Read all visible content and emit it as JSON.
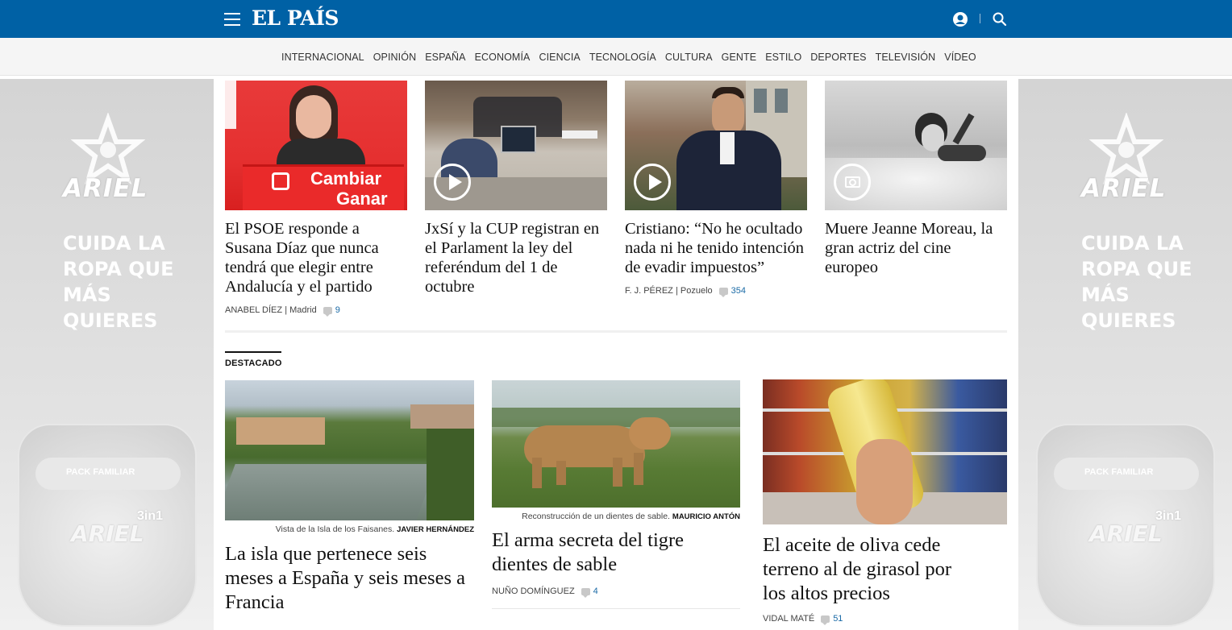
{
  "header": {
    "logo": "EL PAÍS",
    "bg_color": "#0061a5"
  },
  "nav": {
    "items": [
      "INTERNACIONAL",
      "OPINIÓN",
      "ESPAÑA",
      "ECONOMÍA",
      "CIENCIA",
      "TECNOLOGÍA",
      "CULTURA",
      "GENTE",
      "ESTILO",
      "DEPORTES",
      "TELEVISIÓN",
      "VÍDEO"
    ]
  },
  "ad": {
    "brand": "ARIEL",
    "slogan": "CUIDA LA ROPA QUE MÁS QUIERES",
    "pack_text": "PACK FAMILIAR",
    "pack_badge": "3in1"
  },
  "top_stories": [
    {
      "headline": "El PSOE responde a Susana Díaz que nunca tendrá que elegir entre Andalucía y el partido",
      "author": "ANABEL DÍEZ",
      "location": "| Madrid",
      "comments": "9",
      "media": "none",
      "image_icon": "politician-at-podium-image"
    },
    {
      "headline": "JxSí y la CUP registran en el Parlament la ley del referéndum del 1 de octubre",
      "author": "",
      "location": "",
      "comments": "",
      "media": "video",
      "image_icon": "parliament-registry-image"
    },
    {
      "headline": "Cristiano: “No he ocultado nada ni he tenido intención de evadir impuestos”",
      "author": "F. J. PÉREZ",
      "location": "| Pozuelo",
      "comments": "354",
      "media": "video",
      "image_icon": "footballer-portrait-image"
    },
    {
      "headline": "Muere Jeanne Moreau, la gran actriz del cine europeo",
      "author": "",
      "location": "",
      "comments": "",
      "media": "gallery",
      "image_icon": "actress-bw-photo-image"
    }
  ],
  "section": {
    "label": "DESTACADO"
  },
  "featured": [
    {
      "caption": "Vista de la Isla de los Faisanes.",
      "credit": "JAVIER HERNÁNDEZ",
      "headline": "La isla que pertenece seis meses a España y seis meses a Francia",
      "author": "",
      "comments": ""
    },
    {
      "caption": "Reconstrucción de un dientes de sable.",
      "credit": "MAURICIO ANTÓN",
      "headline": "El arma secreta del tigre dientes de sable",
      "author": "NUÑO DOMÍNGUEZ",
      "comments": "4"
    },
    {
      "caption": "",
      "credit": "",
      "headline": "El aceite de oliva cede terreno al de girasol por los altos precios",
      "author": "VIDAL MATÉ",
      "comments": "51"
    }
  ]
}
